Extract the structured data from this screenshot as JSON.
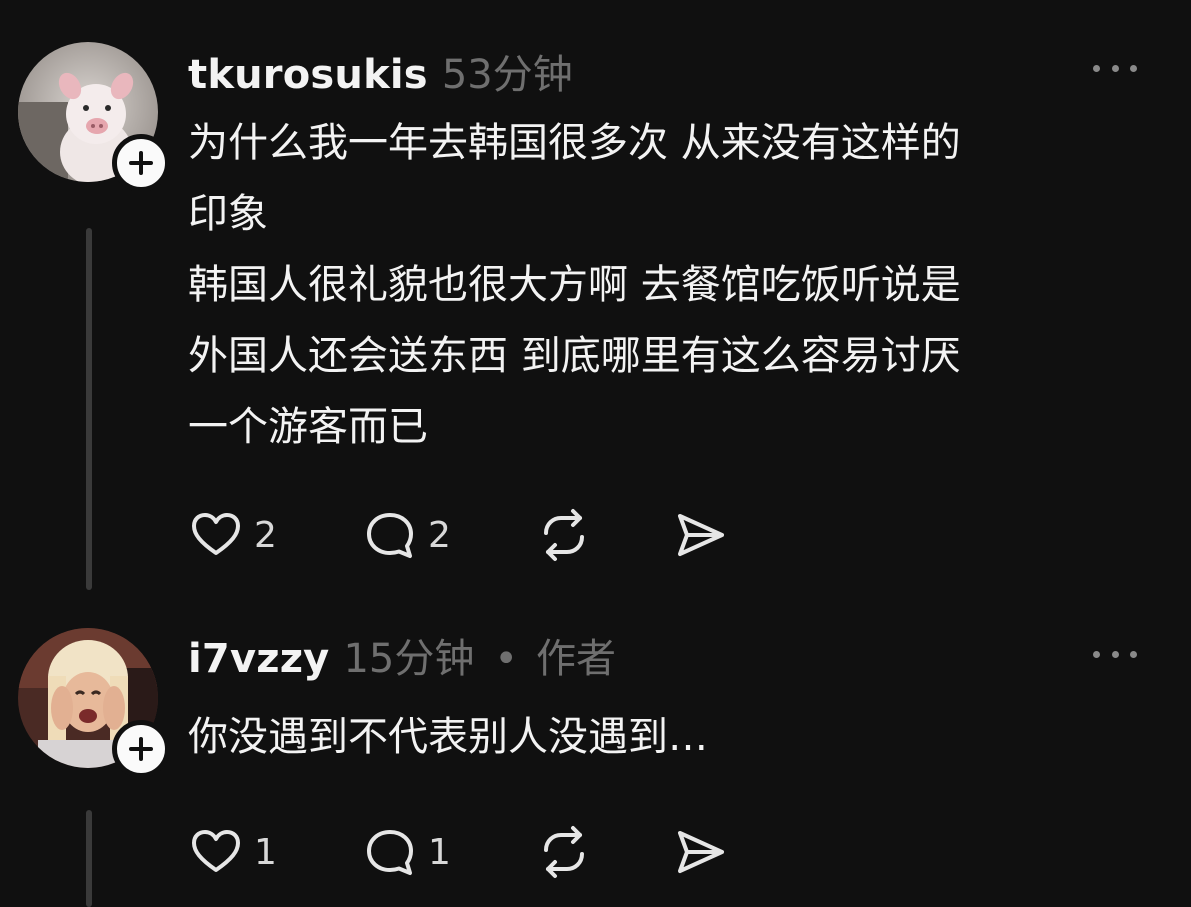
{
  "colors": {
    "background": "#101010",
    "text": "#f3f3f3",
    "muted": "#6f6f6f",
    "thread_line": "#3a3a3a"
  },
  "posts": [
    {
      "username": "tkurosukis",
      "timestamp": "53分钟",
      "author_tag": "",
      "avatar_icon": "pig-avatar",
      "body": "为什么我一年去韩国很多次 从来没有这样的\n印象\n韩国人很礼貌也很大方啊 去餐馆吃饭听说是\n外国人还会送东西 到底哪里有这么容易讨厌\n一个游客而已",
      "likes": "2",
      "replies": "2"
    },
    {
      "username": "i7vzzy",
      "timestamp": "15分钟",
      "separator": "•",
      "author_tag": "作者",
      "avatar_icon": "crying-person-avatar",
      "body": "你没遇到不代表别人没遇到…",
      "likes": "1",
      "replies": "1"
    }
  ]
}
